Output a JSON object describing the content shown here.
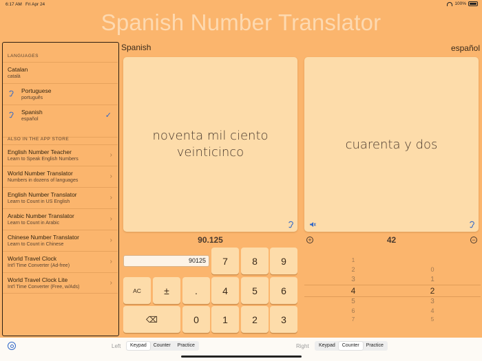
{
  "status": {
    "time": "6:17 AM",
    "date": "Fri Apr 24",
    "battery": "100%"
  },
  "app_title": "Spanish Number Translator",
  "sidebar": {
    "languages_header": "LANGUAGES",
    "languages": [
      {
        "name": "Catalan",
        "native": "català"
      },
      {
        "name": "Portuguese",
        "native": "português"
      },
      {
        "name": "Spanish",
        "native": "español",
        "checkmark": "✓"
      }
    ],
    "appstore_header": "ALSO IN THE APP STORE",
    "apps": [
      {
        "name": "English Number Teacher",
        "desc": "Learn to Speak English Numbers"
      },
      {
        "name": "World Number Translator",
        "desc": "Numbers in dozens of languages"
      },
      {
        "name": "English Number Translator",
        "desc": "Learn to Count in US English"
      },
      {
        "name": "Arabic Number Translator",
        "desc": "Learn to Count in Arabic"
      },
      {
        "name": "Chinese Number Translator",
        "desc": "Learn to Count in Chinese"
      },
      {
        "name": "World Travel Clock",
        "desc": "Int'l Time Converter (Ad-free)"
      },
      {
        "name": "World Travel Clock Lite",
        "desc": "Int'l Time Converter (Free, w/Ads)"
      }
    ],
    "chevron": "›"
  },
  "left_panel": {
    "label": "Spanish",
    "text_line1": "noventa mil ciento",
    "text_line2": "veinticinco",
    "number": "90.125",
    "entry_value": "90125"
  },
  "right_panel": {
    "label": "español",
    "text": "cuarenta y dos",
    "number": "42",
    "plus": "+",
    "minus": "−"
  },
  "keypad": {
    "k7": "7",
    "k8": "8",
    "k9": "9",
    "ac": "AC",
    "pm": "±",
    "dot": ".",
    "k4": "4",
    "k5": "5",
    "k6": "6",
    "backspace": "⌫",
    "k0": "0",
    "k1": "1",
    "k2": "2",
    "k3": "3"
  },
  "picker": {
    "col1": [
      "1",
      "2",
      "3",
      "4",
      "5",
      "6",
      "7"
    ],
    "col2": [
      "0",
      "1",
      "2",
      "3",
      "4",
      "5"
    ]
  },
  "bottom": {
    "left_label": "Left",
    "right_label": "Right",
    "left_segments": [
      "Keypad",
      "Counter",
      "Practice"
    ],
    "right_segments": [
      "Keypad",
      "Counter",
      "Practice"
    ]
  }
}
